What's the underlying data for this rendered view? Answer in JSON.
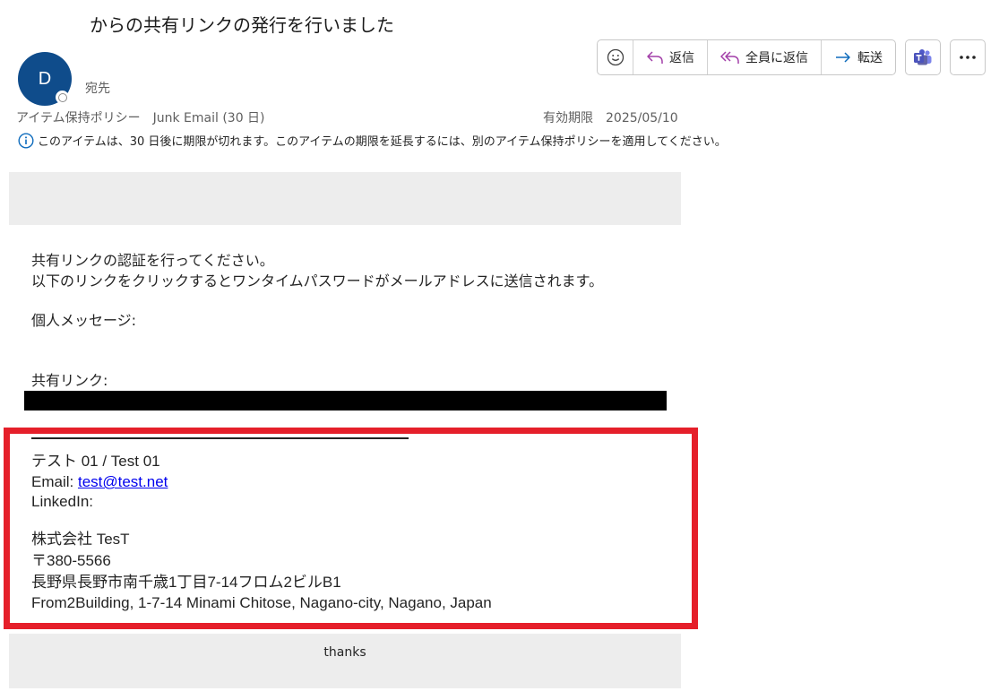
{
  "header": {
    "subject": "からの共有リンクの発行を行いました",
    "avatar_letter": "D",
    "to_label": "宛先"
  },
  "toolbar": {
    "emoji_icon": "smiley-icon",
    "reply_label": "返信",
    "reply_all_label": "全員に返信",
    "forward_label": "転送",
    "teams_icon": "teams-icon",
    "more_icon": "more-icon"
  },
  "policy": {
    "label": "アイテム保持ポリシー　Junk Email (30 日)",
    "expiry": "有効期限　2025/05/10",
    "notice": "このアイテムは、30 日後に期限が切れます。このアイテムの期限を延長するには、別のアイテム保持ポリシーを適用してください。"
  },
  "body": {
    "line1": "共有リンクの認証を行ってください。",
    "line2": "以下のリンクをクリックするとワンタイムパスワードがメールアドレスに送信されます。",
    "personal_message_label": "個人メッセージ:",
    "shared_link_label": "共有リンク:"
  },
  "signature": {
    "name": "テスト 01 / Test 01",
    "email_label": "Email: ",
    "email": "test@test.net",
    "linkedin": "LinkedIn:",
    "company": "株式会社 TesT",
    "postal": "〒380-5566",
    "address_ja": "長野県長野市南千歳1丁目7-14フロム2ビルB1",
    "address_en": "From2Building, 1-7-14 Minami Chitose, Nagano-city, Nagano, Japan"
  },
  "footer": {
    "thanks": "thanks"
  },
  "colors": {
    "highlight_border": "#e51f2a",
    "avatar_bg": "#0f4c8b",
    "reply_icon": "#a23ea8",
    "forward_icon": "#0f6cbd"
  }
}
